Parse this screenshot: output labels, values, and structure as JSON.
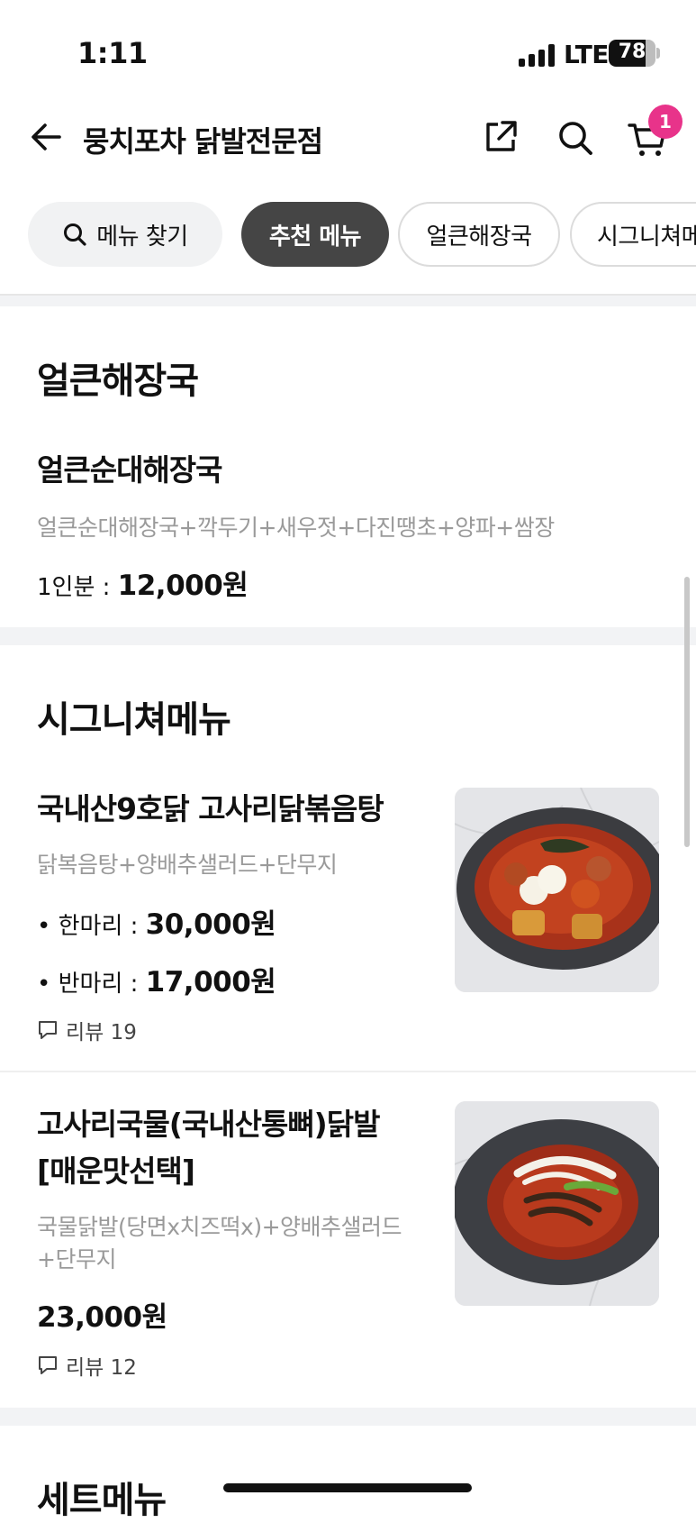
{
  "status_bar": {
    "time": "1:11",
    "network": "LTE",
    "battery": "78",
    "battery_level": 0.78
  },
  "header": {
    "store_name": "뭉치포차 닭발전문점",
    "cart_count": "1"
  },
  "chips": {
    "search_label": "메뉴 찾기",
    "items": [
      "추천 메뉴",
      "얼큰해장국",
      "시그니쳐메뉴"
    ]
  },
  "sections": [
    {
      "title": "얼큰해장국",
      "items": [
        {
          "name": "얼큰순대해장국",
          "desc": "얼큰순대해장국+깍두기+새우젓+다진땡초+양파+쌈장",
          "price_label": "1인분 : ",
          "price": "12,000원"
        }
      ]
    },
    {
      "title": "시그니쳐메뉴",
      "items": [
        {
          "name": "국내산9호닭 고사리닭볶음탕",
          "desc": "닭복음탕+양배추샐러드+단무지",
          "prices": [
            {
              "label": "• 한마리 : ",
              "value": "30,000원"
            },
            {
              "label": "• 반마리 : ",
              "value": "17,000원"
            }
          ],
          "review": "리뷰 19"
        },
        {
          "name_line1": "고사리국물(국내산통뼈)닭발",
          "name_line2": "[매운맛선택]",
          "desc_line1": "국물닭발(당면x치즈떡x)+양배추샐러드",
          "desc_line2": "+단무지",
          "price": "23,000원",
          "review": "리뷰 12"
        }
      ]
    },
    {
      "title": "세트메뉴"
    }
  ],
  "icons": {
    "back": "arrow-left-icon",
    "share": "share-icon",
    "search": "search-icon",
    "cart": "cart-icon",
    "review": "speech-bubble-icon"
  },
  "colors": {
    "badge": "#e8338a",
    "active_chip": "#454545",
    "desc_text": "#9a9a9a"
  }
}
